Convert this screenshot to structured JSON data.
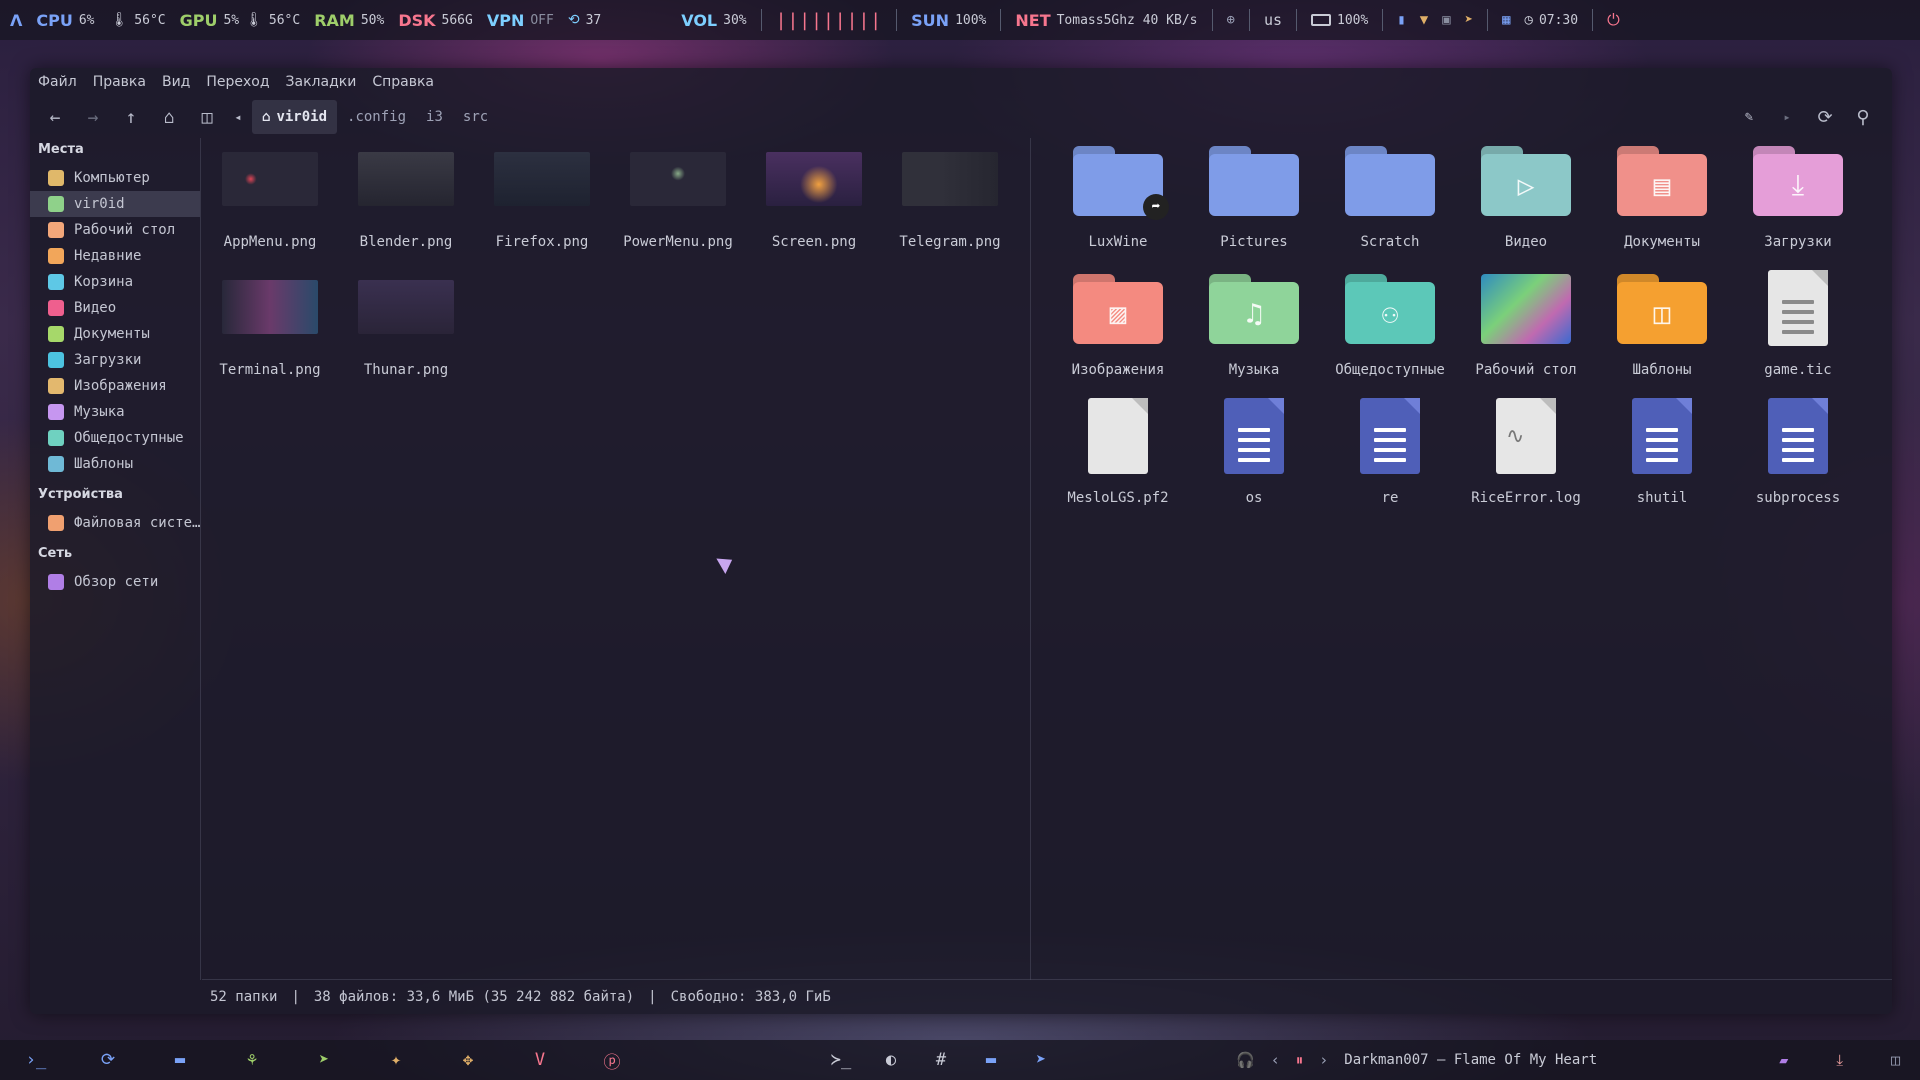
{
  "topbar": {
    "logo": "Λ",
    "cpu_label": "CPU",
    "cpu_value": "6%",
    "cpu_temp": "56°C",
    "gpu_label": "GPU",
    "gpu_value": "5%",
    "gpu_temp": "56°C",
    "ram_label": "RAM",
    "ram_value": "50%",
    "dsk_label": "DSK",
    "dsk_value": "566G",
    "vpn_label": "VPN",
    "vpn_value": "OFF",
    "updates_value": "37",
    "vol_label": "VOL",
    "vol_value": "30%",
    "visualizer": "|||||||||",
    "sun_label": "SUN",
    "sun_value": "100%",
    "net_label": "NET",
    "net_value": "Tomass5Ghz 40 KB/s",
    "layout": "us",
    "battery_value": "100%",
    "time": "07:30",
    "colors": {
      "cpu": "#7aa2f7",
      "gpu": "#9ece6a",
      "ram": "#f7768e",
      "dsk": "#e06c75",
      "vpn": "#7dcfff",
      "vol": "#7dcfff",
      "sun": "#7aa2f7",
      "net": "#f7768e"
    }
  },
  "window": {
    "menu": [
      "Файл",
      "Правка",
      "Вид",
      "Переход",
      "Закладки",
      "Справка"
    ],
    "breadcrumb": [
      "vir0id",
      ".config",
      "i3",
      "src"
    ],
    "sidebar": {
      "places_title": "Места",
      "places": [
        {
          "label": "Компьютер",
          "icon": "computer-icon",
          "color": "#e0b86a"
        },
        {
          "label": "vir0id",
          "icon": "home-icon",
          "color": "#8fd18a"
        },
        {
          "label": "Рабочий стол",
          "icon": "desktop-icon",
          "color": "#f3a77a"
        },
        {
          "label": "Недавние",
          "icon": "recent-icon",
          "color": "#f2a65a"
        },
        {
          "label": "Корзина",
          "icon": "trash-icon",
          "color": "#5ec8e6"
        },
        {
          "label": "Видео",
          "icon": "video-icon",
          "color": "#ef5f8e"
        },
        {
          "label": "Документы",
          "icon": "documents-icon",
          "color": "#a6d86a"
        },
        {
          "label": "Загрузки",
          "icon": "downloads-icon",
          "color": "#4cc2e0"
        },
        {
          "label": "Изображения",
          "icon": "images-icon",
          "color": "#e3b86e"
        },
        {
          "label": "Музыка",
          "icon": "music-icon",
          "color": "#c696f0"
        },
        {
          "label": "Общедоступные",
          "icon": "public-icon",
          "color": "#6fd1c0"
        },
        {
          "label": "Шаблоны",
          "icon": "templates-icon",
          "color": "#6fb9d6"
        }
      ],
      "devices_title": "Устройства",
      "devices": [
        {
          "label": "Файловая систе…",
          "icon": "filesystem-icon",
          "color": "#f0a070"
        }
      ],
      "network_title": "Сеть",
      "network": [
        {
          "label": "Обзор сети",
          "icon": "network-icon",
          "color": "#b07ee6"
        }
      ]
    },
    "left_files": [
      "AppMenu.png",
      "Blender.png",
      "Firefox.png",
      "PowerMenu.png",
      "Screen.png",
      "Telegram.png",
      "Terminal.png",
      "Thunar.png"
    ],
    "right_items": [
      {
        "name": "LuxWine",
        "kind": "folder",
        "color": "#7f9ce8",
        "emblem": "symlink-icon"
      },
      {
        "name": "Pictures",
        "kind": "folder",
        "color": "#7f9ce8"
      },
      {
        "name": "Scratch",
        "kind": "folder",
        "color": "#7f9ce8"
      },
      {
        "name": "Видео",
        "kind": "folder",
        "color": "#8cc8c8",
        "glyph": "▷"
      },
      {
        "name": "Документы",
        "kind": "folder",
        "color": "#f0908a",
        "glyph": "▤"
      },
      {
        "name": "Загрузки",
        "kind": "folder",
        "color": "#e59ed8",
        "glyph": "⤓"
      },
      {
        "name": "Изображения",
        "kind": "folder",
        "color": "#f48a80",
        "glyph": "▨"
      },
      {
        "name": "Музыка",
        "kind": "folder",
        "color": "#8fd49a",
        "glyph": "♫"
      },
      {
        "name": "Общедоступные",
        "kind": "folder",
        "color": "#5cc8b8",
        "glyph": "⚇"
      },
      {
        "name": "Рабочий стол",
        "kind": "desktop",
        "color": "#4aa0c8"
      },
      {
        "name": "Шаблоны",
        "kind": "folder",
        "color": "#f5a030",
        "glyph": "◫"
      },
      {
        "name": "game.tic",
        "kind": "text",
        "color": "#e6e6e6"
      },
      {
        "name": "MesloLGS.pf2",
        "kind": "blank",
        "color": "#e6e6e6"
      },
      {
        "name": "os",
        "kind": "python",
        "color": "#4f5fb8"
      },
      {
        "name": "re",
        "kind": "python",
        "color": "#4f5fb8"
      },
      {
        "name": "RiceError.log",
        "kind": "log",
        "color": "#e6e6e6"
      },
      {
        "name": "shutil",
        "kind": "python",
        "color": "#4f5fb8"
      },
      {
        "name": "subprocess",
        "kind": "python",
        "color": "#4f5fb8"
      }
    ],
    "status": {
      "folders": "52 папки",
      "files": "38 файлов: 33,6 МиБ (35 242 882 байта)",
      "free": "Свободно: 383,0 ГиБ"
    }
  },
  "bottombar": {
    "now_playing": "Darkman007 — Flame Of My Heart",
    "dock_left": [
      "terminal-icon",
      "refresh-icon",
      "folder-icon",
      "python-icon",
      "telegram-icon",
      "bird-icon",
      "game-icon",
      "vim-icon",
      "pinterest-icon"
    ],
    "dock_center": [
      "terminal-prompt-icon",
      "browser-icon",
      "hash-icon",
      "folder-icon",
      "telegram-icon"
    ]
  }
}
